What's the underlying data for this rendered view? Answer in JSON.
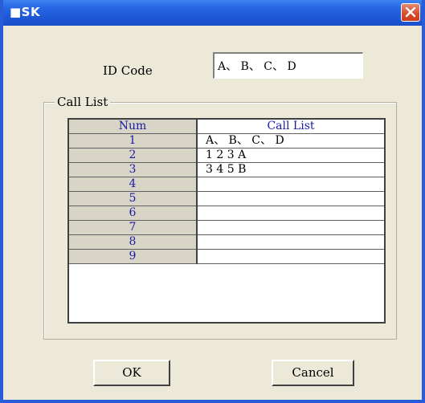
{
  "window": {
    "title": "■SK",
    "colors": {
      "titlebar": "#2766e4",
      "close": "#d64a2a",
      "dialog_bg": "#ece9d8",
      "link_text": "#1a1aa8"
    }
  },
  "id_code": {
    "label": "ID Code",
    "value": "A、 B、 C、 D"
  },
  "call_list": {
    "group_title": "Call List",
    "columns": [
      "Num",
      "Call List"
    ],
    "rows": [
      {
        "num": "1",
        "call": "A、 B、 C、 D"
      },
      {
        "num": "2",
        "call": "1 2 3 A"
      },
      {
        "num": "3",
        "call": "3 4 5 B"
      },
      {
        "num": "4",
        "call": ""
      },
      {
        "num": "5",
        "call": ""
      },
      {
        "num": "6",
        "call": ""
      },
      {
        "num": "7",
        "call": ""
      },
      {
        "num": "8",
        "call": ""
      },
      {
        "num": "9",
        "call": ""
      }
    ]
  },
  "buttons": {
    "ok": "OK",
    "cancel": "Cancel"
  },
  "icons": {
    "close": "close-icon"
  }
}
